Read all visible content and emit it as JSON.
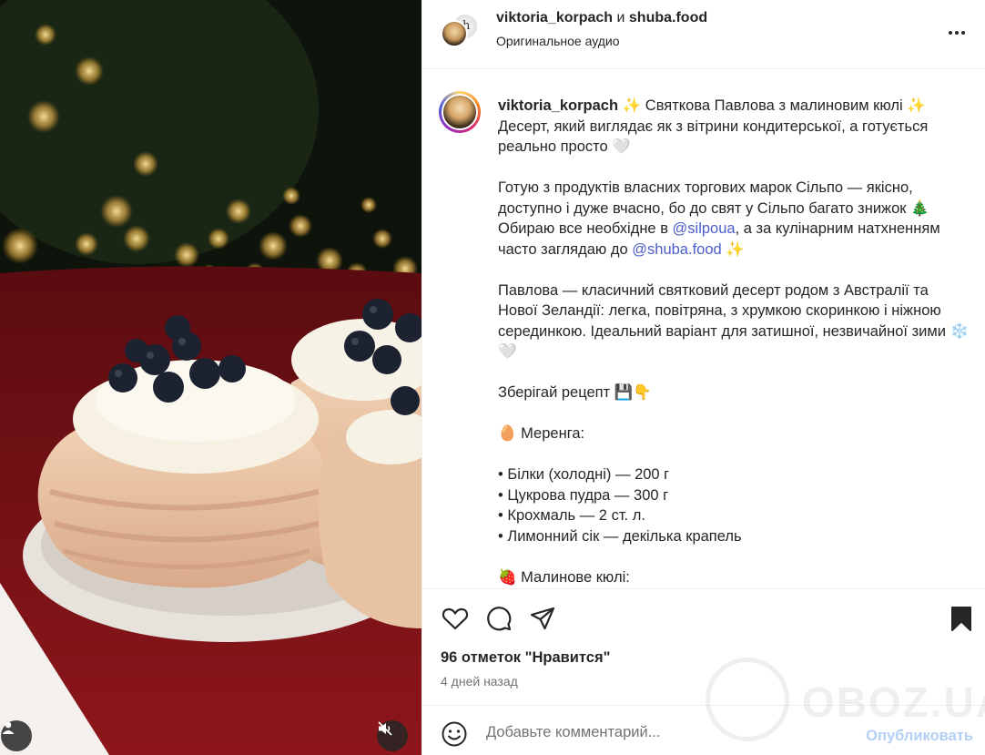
{
  "header": {
    "user1": "viktoria_korpach",
    "conjunction": "и",
    "user2": "shuba.food",
    "subtitle": "Оригинальное аудио"
  },
  "caption": {
    "username": "viktoria_korpach",
    "line1": " ✨ Святкова Павлова з малиновим кюлі ✨",
    "line2": "Десерт, який виглядає як з вітрини кондитерської, а готується реально просто 🤍",
    "para2_a": "Готую з продуктів власних торгових марок Сільпо — якісно, доступно і дуже вчасно, бо до свят у Сільпо багато знижок 🎄",
    "para2_b": "Обираю все необхідне в ",
    "mention1": "@silpoua",
    "para2_c": ", а за кулінарним натхненням часто заглядаю до ",
    "mention2": "@shuba.food",
    "para2_d": " ✨",
    "para3": "Павлова — класичний святковий десерт родом з Австралії та Нової Зеландії: легка, повітряна, з хрумкою скоринкою і ніжною серединкою. Ідеальний варіант для затишної, незвичайної зими ❄️🤍",
    "save": "Зберігай рецепт 💾👇",
    "meringue_title": "🥚 Меренга:",
    "ingredients": [
      "• Білки (холодні) — 200 г",
      "• Цукрова пудра — 300 г",
      "• Крохмаль — 2 ст. л.",
      "• Лимонний сік — декілька крапель"
    ],
    "coulis_title": "🍓 Малинове кюлі:"
  },
  "stats": {
    "likes": "96 отметок \"Нравится\"",
    "date": "4 дней назад"
  },
  "comment": {
    "placeholder": "Добавьте комментарий...",
    "publish": "Опубликовать"
  },
  "icons": {
    "like": "heart-icon",
    "comment": "comment-icon",
    "share": "send-icon",
    "save": "bookmark-icon",
    "emoji": "emoji-icon",
    "more": "more-icon",
    "mute": "muted-speaker-icon",
    "tagged": "user-icon"
  },
  "watermark": "OBOZ.UA",
  "colors": {
    "accent_link": "#4a5dc7",
    "publish_disabled": "#b3cff5",
    "text": "#262626",
    "muted": "#737373"
  }
}
